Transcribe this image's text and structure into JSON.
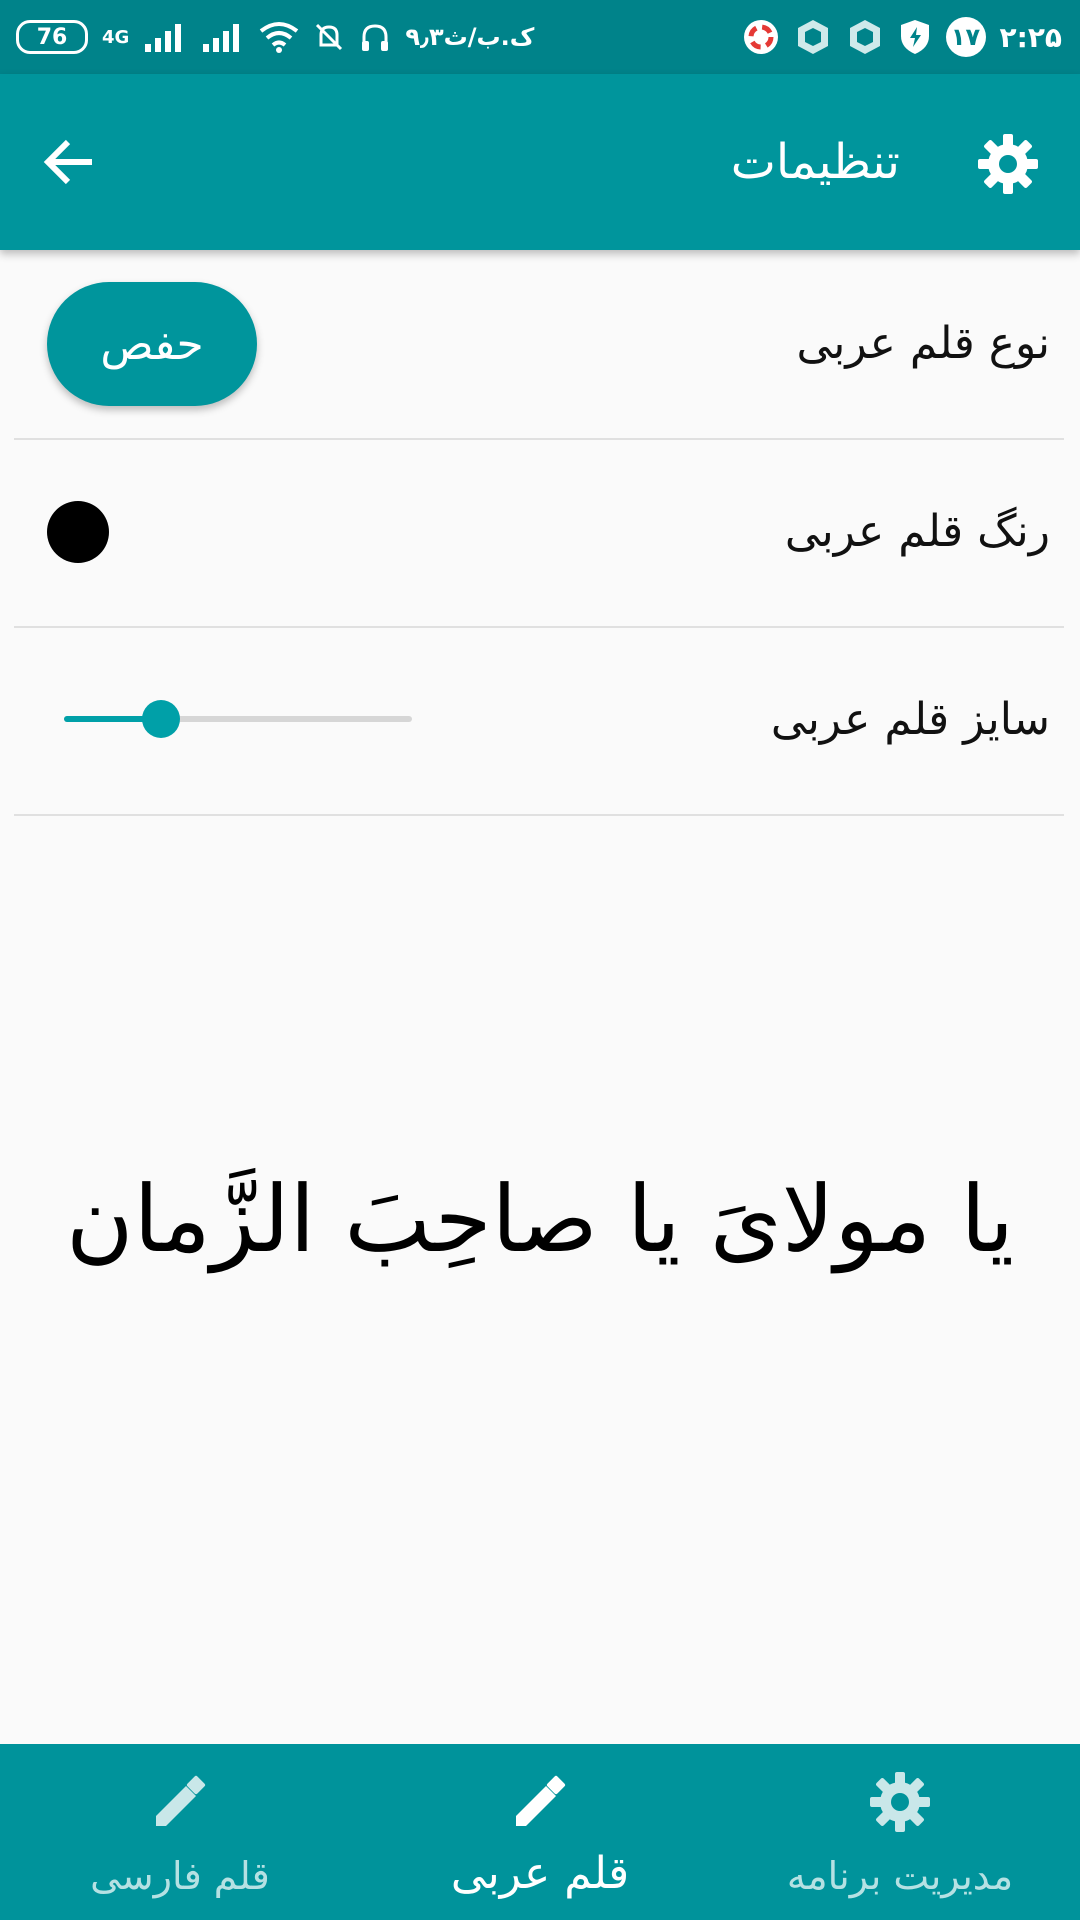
{
  "status_bar": {
    "time": "۲:۲۵",
    "notification_count": "۱۷",
    "net_speed": "۹٫۳ک.ب/ث",
    "network": "4G",
    "battery": "76"
  },
  "app_bar": {
    "title": "تنظیمات",
    "back_icon": "arrow-left-icon",
    "settings_icon": "gear-icon"
  },
  "settings": {
    "font_type_label": "نوع قلم عربی",
    "font_type_value": "حفص",
    "font_color_label": "رنگ قلم عربی",
    "font_color_value": "#000000",
    "font_size_label": "سایز قلم عربی",
    "font_size_level": 0.28
  },
  "preview_text": "یا مولایَ یا صاحِبَ الزَّمان",
  "bottom_nav": {
    "items": [
      {
        "label": "قلم فارسی",
        "icon": "pencil-icon",
        "active": false
      },
      {
        "label": "قلم عربی",
        "icon": "pencil-icon",
        "active": true
      },
      {
        "label": "مدیریت برنامه",
        "icon": "gear-icon",
        "active": false
      }
    ]
  },
  "colors": {
    "primary": "#00959c",
    "status_bar": "#00838a",
    "accent": "#00a0a8"
  }
}
